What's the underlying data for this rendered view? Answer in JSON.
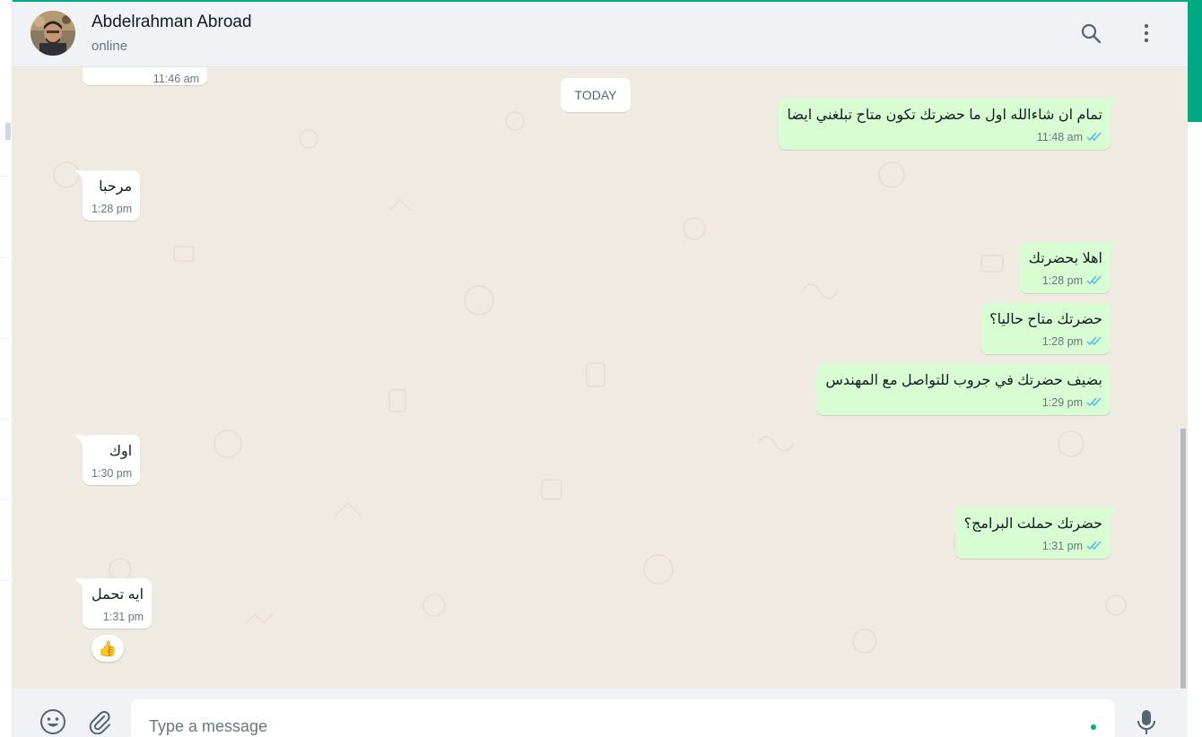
{
  "header": {
    "contact_name": "Abdelrahman Abroad",
    "status": "online",
    "icons": [
      "search-icon",
      "menu-icon"
    ]
  },
  "chat": {
    "day_label": "TODAY",
    "prev_time": "11:46 am",
    "messages": [
      {
        "dir": "out",
        "text": "تمام ان شاءالله اول ما حضرتك تكون متاح تبلغني ايضا",
        "time": "11:48 am",
        "ticks": "read"
      },
      {
        "dir": "in",
        "text": "مرحبا",
        "time": "1:28 pm"
      },
      {
        "dir": "out",
        "text": "اهلا بحضرتك",
        "time": "1:28 pm",
        "ticks": "read"
      },
      {
        "dir": "out",
        "text": "حضرتك متاح حاليا؟",
        "time": "1:28 pm",
        "ticks": "read"
      },
      {
        "dir": "out",
        "text": "بضيف حضرتك في جروب للتواصل مع المهندس",
        "time": "1:29 pm",
        "ticks": "read"
      },
      {
        "dir": "in",
        "text": "اوك",
        "time": "1:30 pm"
      },
      {
        "dir": "out",
        "text": "حضرتك حملت البرامج؟",
        "time": "1:31 pm",
        "ticks": "read"
      },
      {
        "dir": "in",
        "text": "ايه تحمل",
        "time": "1:31 pm",
        "reaction": "👍"
      }
    ]
  },
  "composer": {
    "placeholder": "Type a message",
    "icons": [
      "emoji-icon",
      "attach-icon",
      "mic-icon"
    ]
  },
  "colors": {
    "accent": "#00a884",
    "outgoing_bubble": "#d9fdd3",
    "incoming_bubble": "#ffffff",
    "chat_background": "#efeae2",
    "read_ticks": "#53bdeb"
  }
}
